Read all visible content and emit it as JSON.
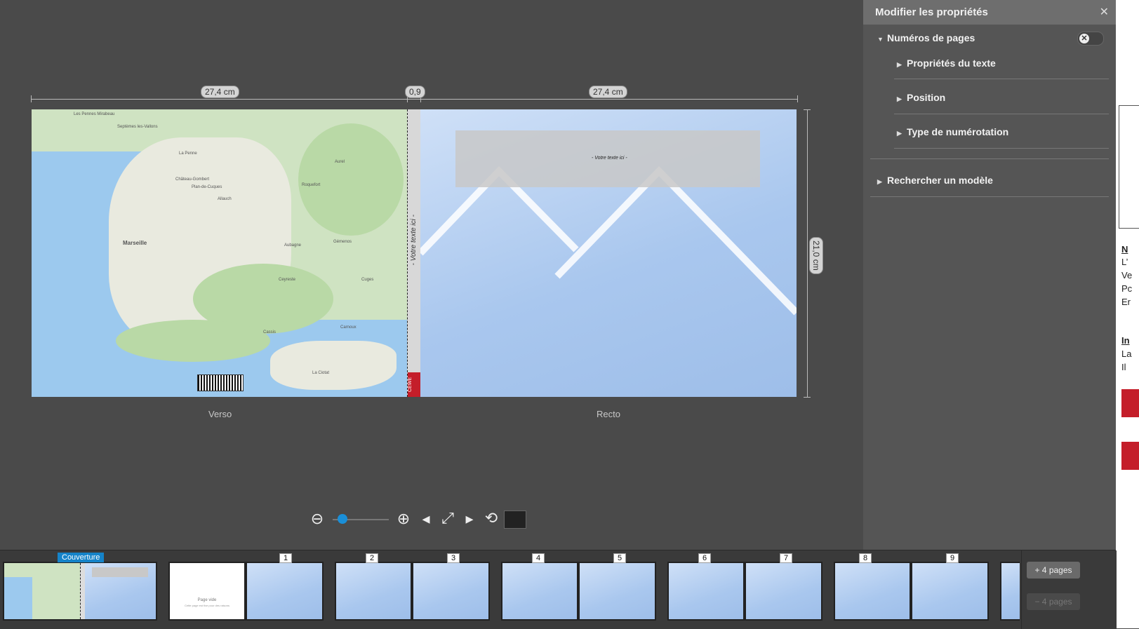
{
  "editor": {
    "dimensions": {
      "verso_width": "27,4 cm",
      "spine_width": "0,9",
      "recto_width": "27,4 cm",
      "height": "21,0 cm"
    },
    "spine_text": "- Votre texte ici -",
    "spine_logo": "CEWE",
    "recto_placeholder_text": "- Votre texte ici -",
    "captions": {
      "verso": "Verso",
      "recto": "Recto"
    },
    "map_labels": [
      "Les Pennes Mirabeau",
      "Septèmes les-Vallons",
      "Allauch",
      "Aubagne",
      "Marseille",
      "Cassis",
      "Carnoux",
      "La Ciotat",
      "Roquefort",
      "Aurel",
      "Plan-de-Cuques",
      "Château-Gombert",
      "La Penne",
      "Gémenos",
      "Cuges",
      "Ceyreste"
    ]
  },
  "toolbar": {
    "zoom_out_icon": "zoom-out-icon",
    "zoom_in_icon": "zoom-in-icon",
    "zoom_level": 0.18
  },
  "panel": {
    "title": "Modifier les propriétés",
    "section": "Numéros de pages",
    "items": [
      {
        "label": "Propriétés du texte"
      },
      {
        "label": "Position"
      },
      {
        "label": "Type de numérotation"
      }
    ],
    "search_template": "Rechercher un modèle",
    "toggle_state": "off"
  },
  "doc_strip": {
    "lines": [
      "N",
      "L’",
      "Ve",
      "Pc",
      "Er",
      "In",
      "La",
      "Il"
    ]
  },
  "filmstrip": {
    "cover_label": "Couverture",
    "blank_page_title": "Page vide",
    "blank_page_subtitle": "Cette page est fixe pour des raisons",
    "page_numbers": [
      "1",
      "2",
      "3",
      "4",
      "5",
      "6",
      "7",
      "8",
      "9"
    ],
    "add_pages": "+ 4 pages",
    "remove_pages": "− 4 pages"
  }
}
